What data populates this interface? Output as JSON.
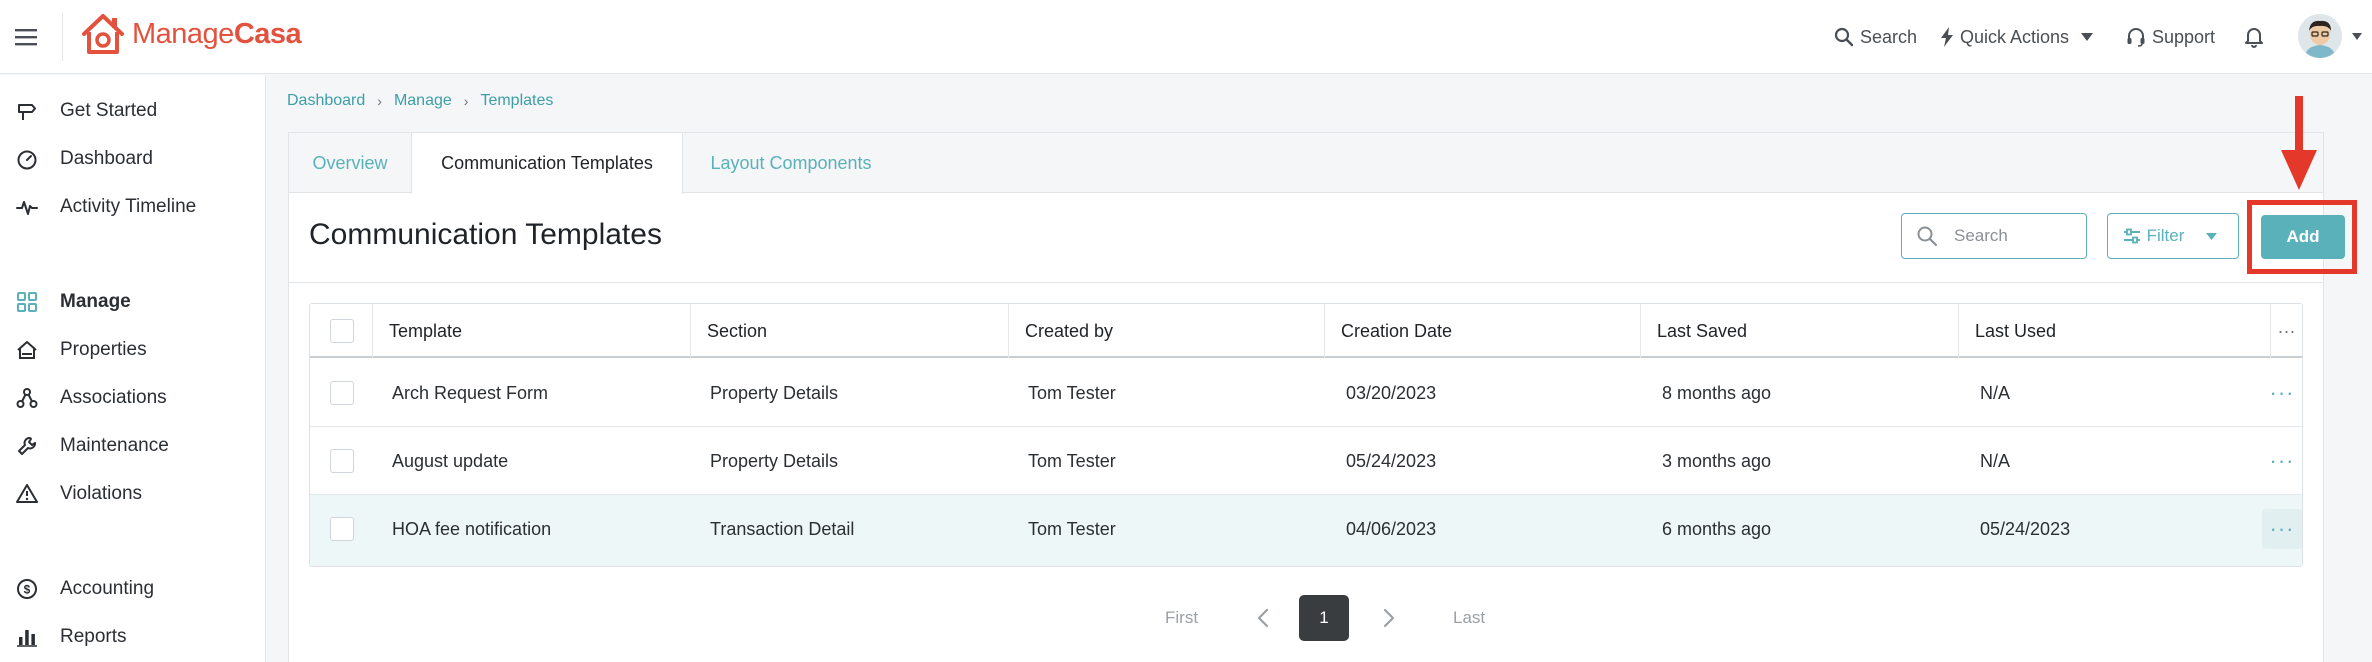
{
  "header": {
    "logo_text_a": "Manage",
    "logo_text_b": "Casa",
    "search_label": "Search",
    "quick_actions_label": "Quick Actions",
    "support_label": "Support"
  },
  "sidebar": {
    "items": [
      {
        "label": "Get Started",
        "icon": "signpost-icon"
      },
      {
        "label": "Dashboard",
        "icon": "gauge-icon"
      },
      {
        "label": "Activity Timeline",
        "icon": "pulse-icon"
      },
      {
        "label": "Manage",
        "icon": "grid-icon"
      },
      {
        "label": "Properties",
        "icon": "house-icon"
      },
      {
        "label": "Associations",
        "icon": "network-icon"
      },
      {
        "label": "Maintenance",
        "icon": "wrench-icon"
      },
      {
        "label": "Violations",
        "icon": "warning-icon"
      },
      {
        "label": "Accounting",
        "icon": "dollar-icon"
      },
      {
        "label": "Reports",
        "icon": "bar-chart-icon"
      }
    ]
  },
  "breadcrumb": [
    "Dashboard",
    "Manage",
    "Templates"
  ],
  "tabs": [
    "Overview",
    "Communication Templates",
    "Layout Components"
  ],
  "page": {
    "title": "Communication Templates",
    "search_placeholder": "Search",
    "filter_label": "Filter",
    "add_label": "Add"
  },
  "table": {
    "columns": [
      "Template",
      "Section",
      "Created by",
      "Creation Date",
      "Last Saved",
      "Last Used"
    ],
    "rows": [
      [
        "Arch Request Form",
        "Property Details",
        "Tom Tester",
        "03/20/2023",
        "8 months ago",
        "N/A"
      ],
      [
        "August update",
        "Property Details",
        "Tom Tester",
        "05/24/2023",
        "3 months ago",
        "N/A"
      ],
      [
        "HOA fee notification",
        "Transaction Detail",
        "Tom Tester",
        "04/06/2023",
        "6 months ago",
        "05/24/2023"
      ]
    ],
    "more_glyph": "···"
  },
  "pagination": {
    "first": "First",
    "last": "Last",
    "current": "1"
  },
  "colors": {
    "accent": "#5bb1ba",
    "brand": "#e2523e",
    "highlight": "#e4392a"
  }
}
